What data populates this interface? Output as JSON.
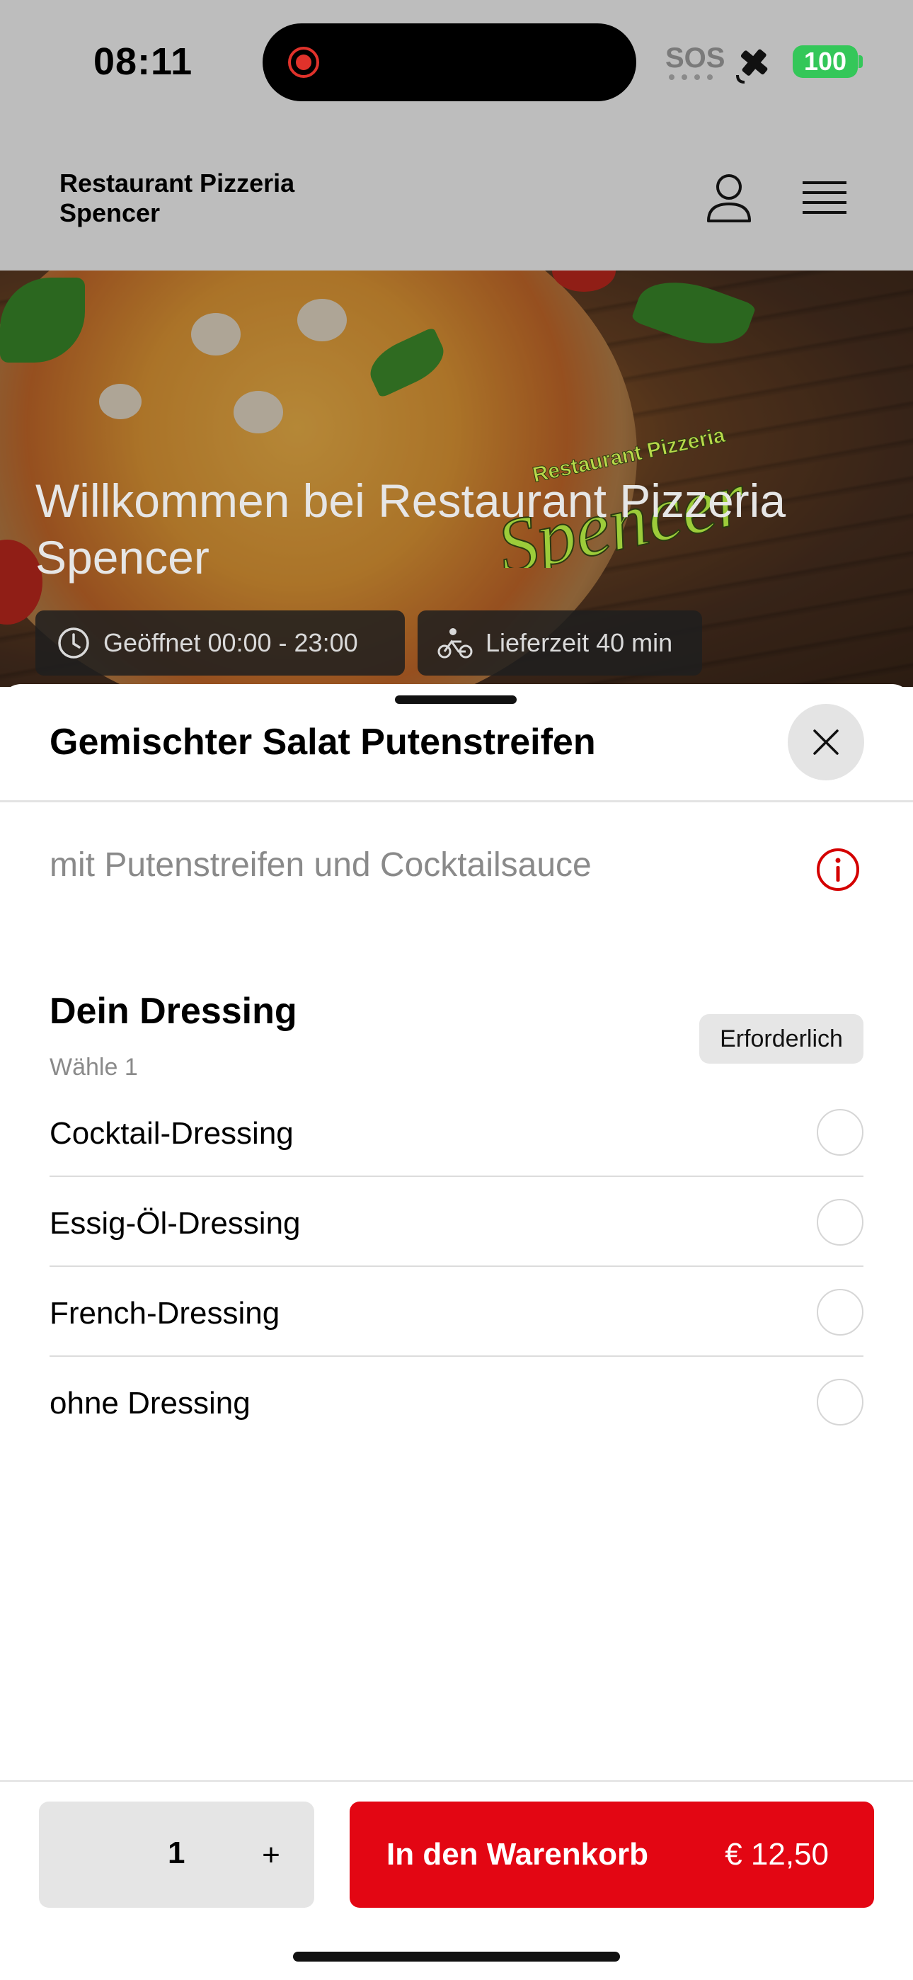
{
  "status_bar": {
    "time": "08:11",
    "sos": "SOS",
    "battery": "100"
  },
  "header": {
    "restaurant_name": "Restaurant Pizzeria Spencer"
  },
  "hero": {
    "title": "Willkommen bei Restaurant Pizzeria Spencer",
    "logo_text_top": "Restaurant Pizzeria",
    "logo_text_bottom": "Spencer",
    "opening_hours": "Geöffnet 00:00 - 23:00",
    "delivery_time": "Lieferzeit 40 min"
  },
  "product": {
    "title": "Gemischter Salat Putenstreifen",
    "description": "mit Putenstreifen und Cocktailsauce"
  },
  "dressing": {
    "title": "Dein Dressing",
    "subtitle": "Wähle 1",
    "badge": "Erforderlich",
    "options": [
      {
        "label": "Cocktail-Dressing",
        "selected": false
      },
      {
        "label": "Essig-Öl-Dressing",
        "selected": false
      },
      {
        "label": "French-Dressing",
        "selected": false
      },
      {
        "label": "ohne Dressing",
        "selected": false
      }
    ]
  },
  "footer": {
    "quantity": "1",
    "plus_label": "+",
    "cart_label": "In den Warenkorb",
    "price": "€ 12,50"
  },
  "colors": {
    "accent": "#e30613",
    "battery": "#34c759",
    "info": "#d40000"
  }
}
